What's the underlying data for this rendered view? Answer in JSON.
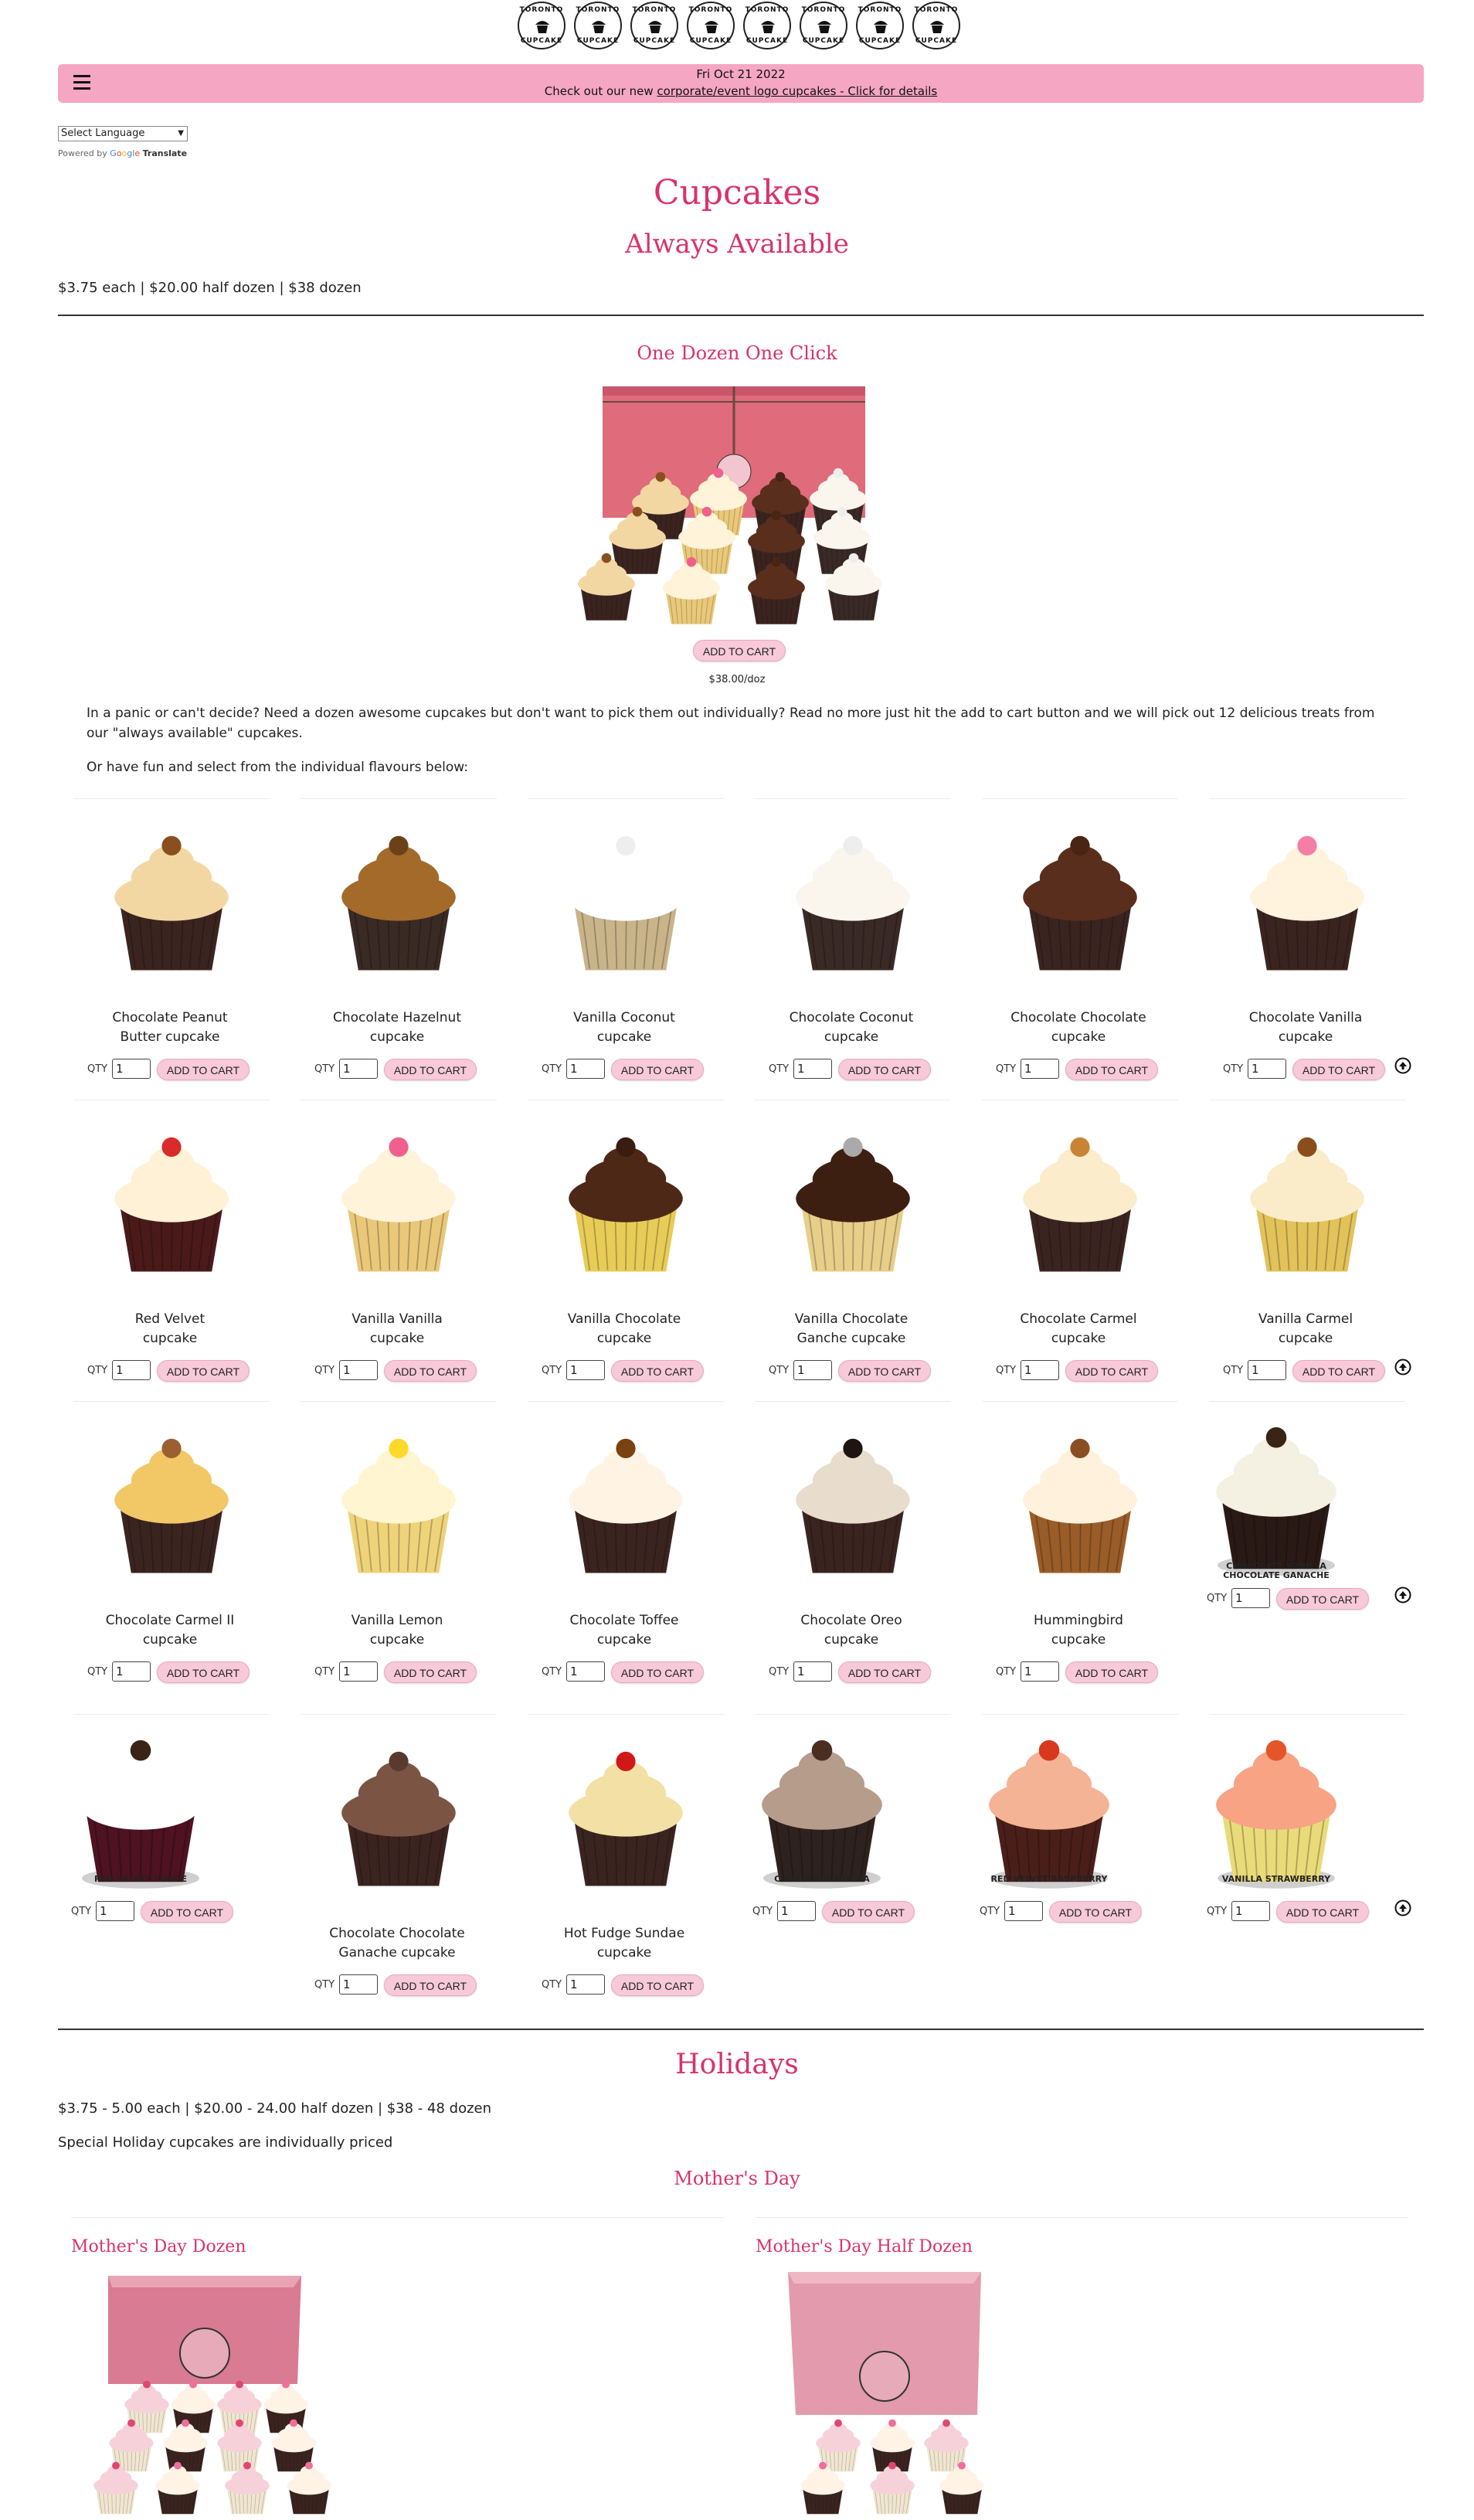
{
  "logo": {
    "ring_top": "TORONTO",
    "ring_bottom": "CUPCAKE",
    "count": 8
  },
  "header": {
    "menu_icon": "hamburger-icon",
    "date": "Fri Oct 21 2022",
    "promo_prefix": "Check out our new ",
    "promo_link": "corporate/event logo cupcakes - Click for details"
  },
  "translate": {
    "select_value": "Select Language",
    "powered_by": "Powered by",
    "google": [
      "G",
      "o",
      "o",
      "g",
      "l",
      "e"
    ],
    "translate_label": "Translate"
  },
  "page": {
    "title": "Cupcakes",
    "subtitle": "Always Available",
    "price_line": "$3.75 each | $20.00 half dozen | $38 dozen"
  },
  "dozen": {
    "title": "One Dozen One Click",
    "add_label": "ADD TO CART",
    "price": "$38.00/doz",
    "desc1": "In a panic or can't decide? Need a dozen awesome cupcakes but don't want to pick them out individually? Read no more just hit the add to cart button and we will pick out 12 delicious treats from our \"always available\" cupcakes.",
    "desc2": "Or have fun and select from the individual flavours below:"
  },
  "qty_label": "QTY",
  "qty_default": "1",
  "add_label": "ADD TO CART",
  "products": [
    {
      "line1": "Chocolate Peanut",
      "line2": "Butter cupcake",
      "cake": "#3b2420",
      "frost": "#f3d7a3",
      "topping": "#8a4f1e"
    },
    {
      "line1": "Chocolate Hazelnut",
      "line2": "cupcake",
      "cake": "#3a2a24",
      "frost": "#a36a2a",
      "topping": "#6b4218"
    },
    {
      "line1": "Vanilla Coconut",
      "line2": "cupcake",
      "cake": "#c9b48a",
      "frost": "#ffffff",
      "topping": "#eeeeee"
    },
    {
      "line1": "Chocolate Coconut",
      "line2": "cupcake",
      "cake": "#3a2a26",
      "frost": "#faf6ee",
      "topping": "#eeeeee"
    },
    {
      "line1": "Chocolate Chocolate",
      "line2": "cupcake",
      "cake": "#3b2420",
      "frost": "#5a2e1d",
      "topping": "#4a2414"
    },
    {
      "line1": "Chocolate Vanilla",
      "line2": "cupcake",
      "cake": "#3b2420",
      "frost": "#fff3de",
      "topping": "#f57ea5"
    },
    {
      "line1": "Red Velvet",
      "line2": "cupcake",
      "cake": "#4a1a1a",
      "frost": "#fff1d6",
      "topping": "#d92b2b"
    },
    {
      "line1": "Vanilla Vanilla",
      "line2": "cupcake",
      "cake": "#e9c87a",
      "frost": "#fff3da",
      "topping": "#f0608c"
    },
    {
      "line1": "Vanilla Chocolate",
      "line2": "cupcake",
      "cake": "#e8cc58",
      "frost": "#4e2816",
      "topping": "#3a1c10"
    },
    {
      "line1": "Vanilla Chocolate",
      "line2": "Ganche cupcake",
      "cake": "#e7cf8a",
      "frost": "#3d1f12",
      "topping": "#aaaaaa"
    },
    {
      "line1": "Chocolate Carmel",
      "line2": "cupcake",
      "cake": "#3b2420",
      "frost": "#fbeccb",
      "topping": "#c88434"
    },
    {
      "line1": "Vanilla Carmel",
      "line2": "cupcake",
      "cake": "#e2c25a",
      "frost": "#fbecc9",
      "topping": "#8a4e1d"
    },
    {
      "line1": "Chocolate Carmel II",
      "line2": "cupcake",
      "cake": "#3b2420",
      "frost": "#f2c766",
      "topping": "#9a6032"
    },
    {
      "line1": "Vanilla Lemon",
      "line2": "cupcake",
      "cake": "#efd37a",
      "frost": "#fff5d0",
      "topping": "#ffd92a"
    },
    {
      "line1": "Chocolate Toffee",
      "line2": "cupcake",
      "cake": "#3b2420",
      "frost": "#fff4e4",
      "topping": "#7a4210"
    },
    {
      "line1": "Chocolate Oreo",
      "line2": "cupcake",
      "cake": "#3b2420",
      "frost": "#e8dccc",
      "topping": "#1e1410"
    },
    {
      "line1": "Hummingbird",
      "line2": "cupcake",
      "cake": "#9a5c28",
      "frost": "#fff1dc",
      "topping": "#8a4e22"
    },
    {
      "line1": "",
      "line2": "",
      "cake": "#2a1a16",
      "frost": "#f4f1e2",
      "topping": "#3a2416",
      "caption": "CHOCOLATE VANILLA CHOCOLATE GANACHE"
    },
    {
      "line1": "",
      "line2": "",
      "cake": "#4e1222",
      "frost": "#ffffff",
      "topping": "#3a2416",
      "caption": "RED VELVET FUDGE"
    },
    {
      "line1": "Chocolate Chocolate",
      "line2": "Ganache cupcake",
      "cake": "#3b2420",
      "frost": "#7c5444",
      "topping": "#5a3a2e"
    },
    {
      "line1": "Hot Fudge Sundae",
      "line2": "cupcake",
      "cake": "#3b2420",
      "frost": "#f3e0a5",
      "topping": "#d01818"
    },
    {
      "line1": "",
      "line2": "",
      "cake": "#2e221e",
      "frost": "#b69c8a",
      "topping": "#4a2e20",
      "caption": "CHOCOLATE MOCHA"
    },
    {
      "line1": "",
      "line2": "",
      "cake": "#4a1f1a",
      "frost": "#f4b394",
      "topping": "#d8381e",
      "caption": "RED VELVET RASPBERRY"
    },
    {
      "line1": "",
      "line2": "",
      "cake": "#eadb7a",
      "frost": "#f7a384",
      "topping": "#e4552a",
      "caption": "VANILLA STRAWBERRY"
    }
  ],
  "holidays": {
    "title": "Holidays",
    "price_line": "$3.75 - 5.00 each | $20.00 - 24.00 half dozen | $38 - 48 dozen",
    "note": "Special Holiday cupcakes are individually priced",
    "category": "Mother's Day",
    "items": [
      "Mother's Day Dozen",
      "Mother's Day Half Dozen"
    ]
  },
  "colors": {
    "accent": "#d8336a",
    "header_bg": "#f5a6c3",
    "button_bg": "#f7c9d9"
  }
}
